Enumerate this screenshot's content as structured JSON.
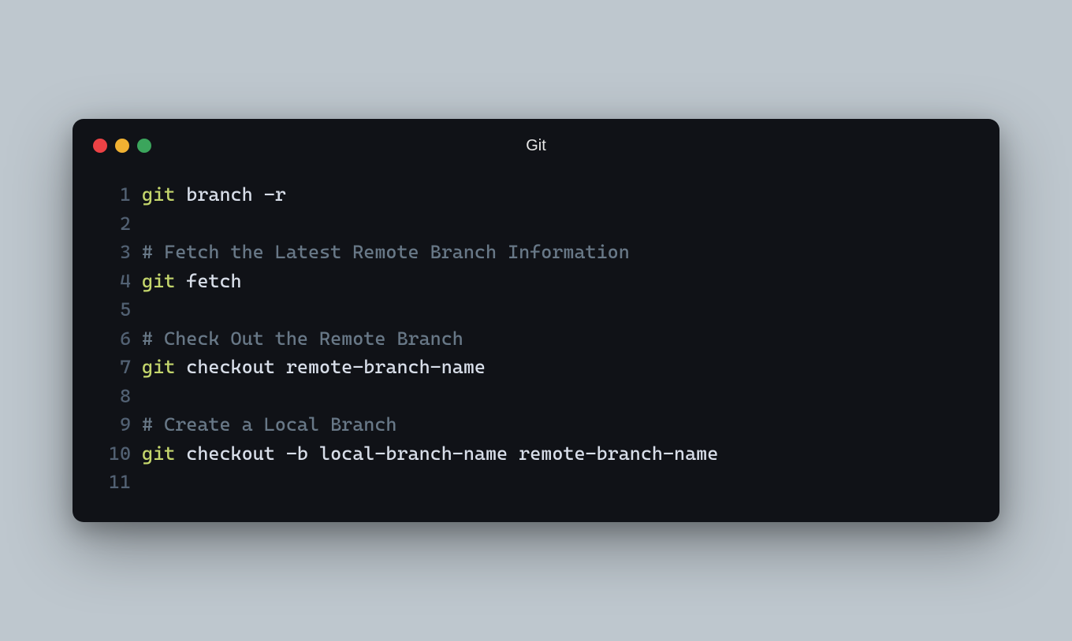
{
  "window": {
    "title": "Git"
  },
  "colors": {
    "background": "#BEC7CE",
    "terminal_bg": "#101217",
    "traffic_red": "#ED4245",
    "traffic_yellow": "#F0B132",
    "traffic_green": "#3BA55C",
    "line_number": "#526173",
    "keyword": "#C4D66C",
    "text": "#D8DEE9",
    "comment": "#687887"
  },
  "code": {
    "lines": [
      {
        "n": "1",
        "tokens": [
          {
            "t": "git",
            "c": "keyword"
          },
          {
            "t": " branch -r",
            "c": "text"
          }
        ]
      },
      {
        "n": "2",
        "tokens": []
      },
      {
        "n": "3",
        "tokens": [
          {
            "t": "# Fetch the Latest Remote Branch Information",
            "c": "comment"
          }
        ]
      },
      {
        "n": "4",
        "tokens": [
          {
            "t": "git",
            "c": "keyword"
          },
          {
            "t": " fetch",
            "c": "text"
          }
        ]
      },
      {
        "n": "5",
        "tokens": []
      },
      {
        "n": "6",
        "tokens": [
          {
            "t": "# Check Out the Remote Branch",
            "c": "comment"
          }
        ]
      },
      {
        "n": "7",
        "tokens": [
          {
            "t": "git",
            "c": "keyword"
          },
          {
            "t": " checkout remote-branch-name",
            "c": "text"
          }
        ]
      },
      {
        "n": "8",
        "tokens": []
      },
      {
        "n": "9",
        "tokens": [
          {
            "t": "# Create a Local Branch",
            "c": "comment"
          }
        ]
      },
      {
        "n": "10",
        "tokens": [
          {
            "t": "git",
            "c": "keyword"
          },
          {
            "t": " checkout -b local-branch-name remote-branch-name",
            "c": "text"
          }
        ]
      },
      {
        "n": "11",
        "tokens": []
      }
    ]
  }
}
